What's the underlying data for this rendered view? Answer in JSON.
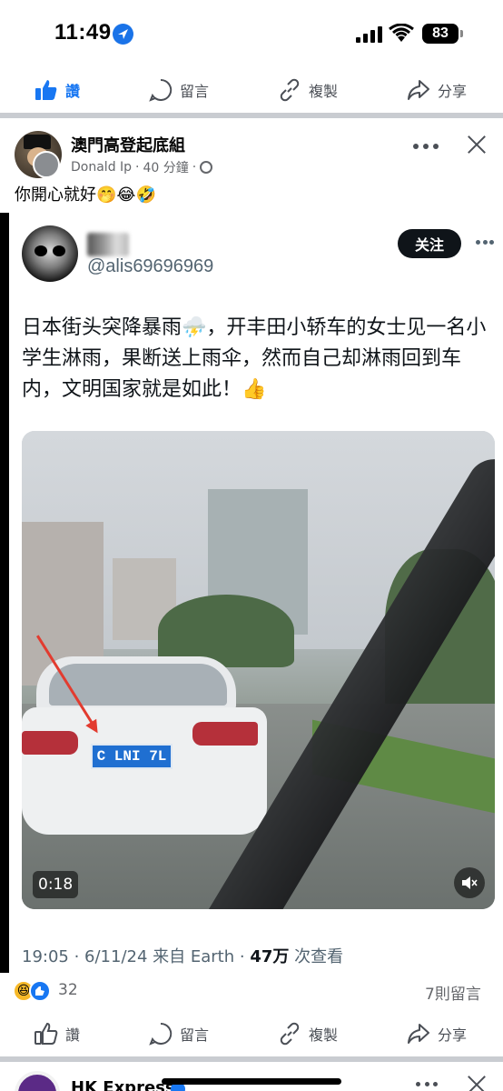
{
  "status_bar": {
    "time": "11:49",
    "battery": "83"
  },
  "top_actions": [
    {
      "label": "讚",
      "icon": "like-icon"
    },
    {
      "label": "留言",
      "icon": "comment-icon"
    },
    {
      "label": "複製",
      "icon": "link-icon"
    },
    {
      "label": "分享",
      "icon": "share-icon"
    }
  ],
  "post": {
    "group_name": "澳門高登起底組",
    "author": "Donald Ip",
    "time_ago": "40 分鐘",
    "text": "你開心就好🤭😂🤣"
  },
  "tweet": {
    "handle": "@alis69696969",
    "follow_label": "关注",
    "text": "日本街头突降暴雨⛈️，开丰田小轿车的女士见一名小学生淋雨，果断送上雨伞，然而自己却淋雨回到车内，文明国家就是如此！👍",
    "video_time": "0:18",
    "plate_text": "C LNI 7L",
    "timestamp": "19:05 · 6/11/24 来自 Earth · ",
    "views_number": "47万",
    "views_label": " 次查看"
  },
  "reactions": {
    "count": "32",
    "comments": "7則留言"
  },
  "bottom_actions": [
    {
      "label": "讚",
      "icon": "like-icon"
    },
    {
      "label": "留言",
      "icon": "comment-icon"
    },
    {
      "label": "複製",
      "icon": "link-icon"
    },
    {
      "label": "分享",
      "icon": "share-icon"
    }
  ],
  "next_post": {
    "name": "HK Express"
  },
  "colors": {
    "accent": "#1877f2",
    "text": "#050505",
    "muted": "#65676b"
  }
}
